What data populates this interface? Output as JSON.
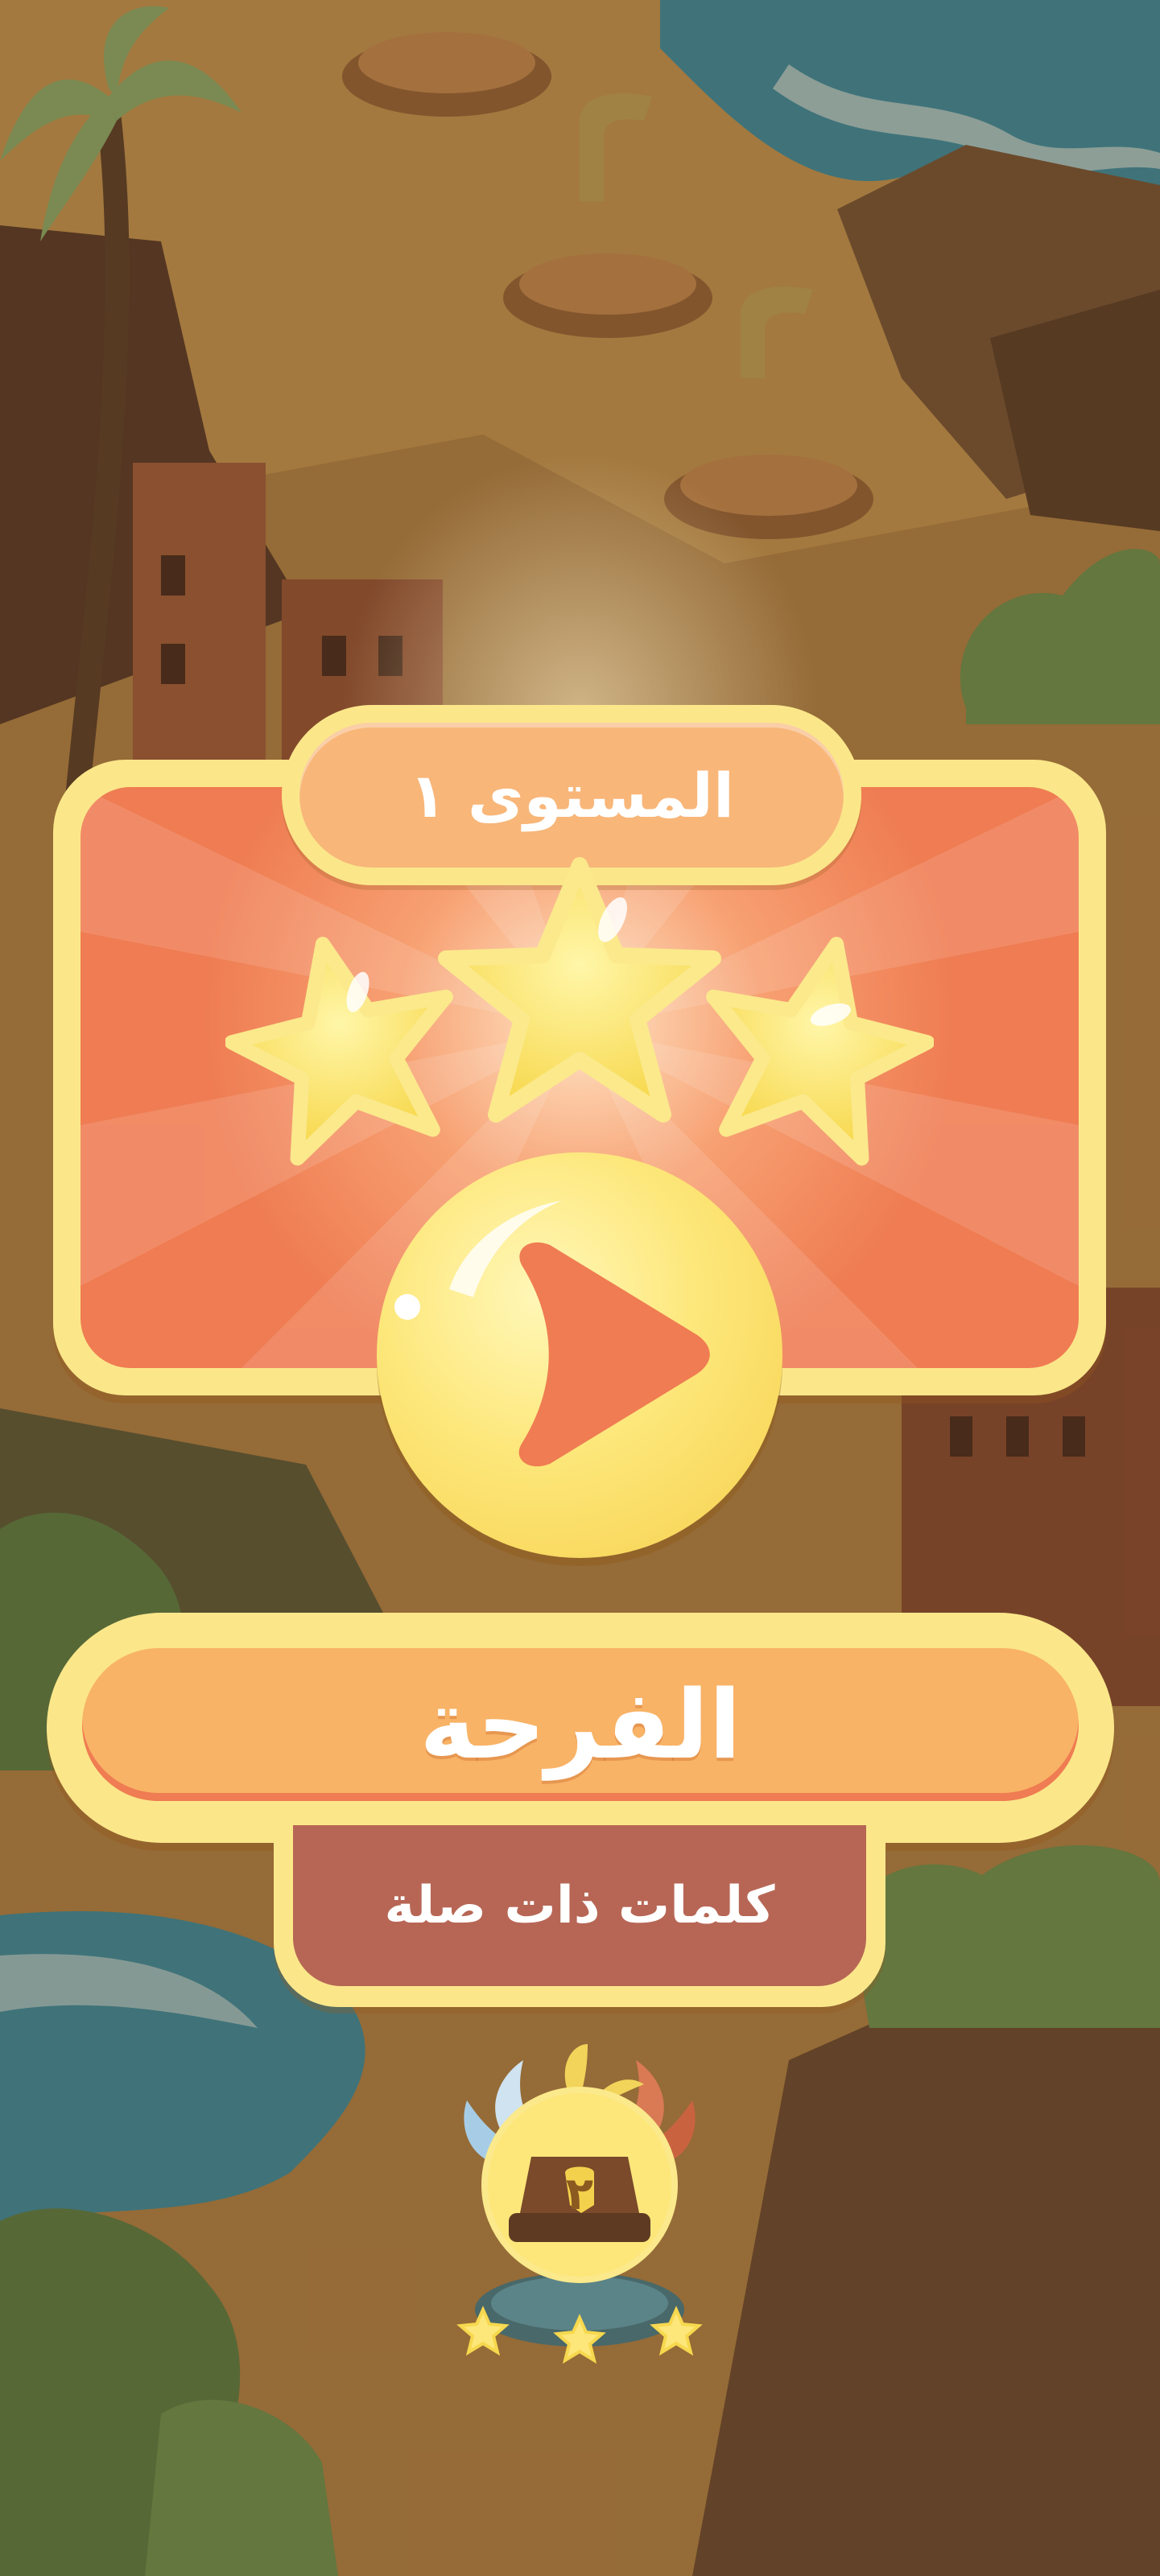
{
  "level": {
    "label": "المستوى ١",
    "stars_earned": 3,
    "stars_total": 3
  },
  "play": {
    "icon": "play-icon"
  },
  "category": {
    "title": "الفرحة",
    "subtitle": "كلمات ذات صلة"
  },
  "next_level_node": {
    "icon": "trophy-icon",
    "number": "٢",
    "stars_earned": 3
  },
  "colors": {
    "frame_yellow": "#fbe78a",
    "card_orange": "#ef7c52",
    "pill_orange": "#f8b366",
    "subtitle_brown": "#b76655",
    "text_white": "#ffffff"
  }
}
